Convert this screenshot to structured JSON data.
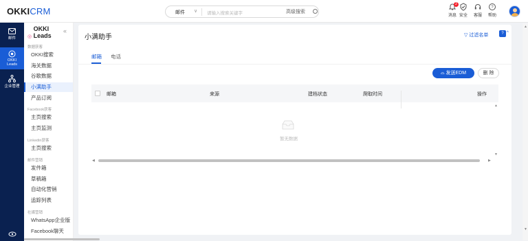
{
  "brand": {
    "logo_okki": "OKKI",
    "logo_crm": "CRM"
  },
  "search": {
    "type_label": "邮件",
    "placeholder": "请输入搜索关键字",
    "advanced_label": "高级搜索"
  },
  "top_actions": [
    {
      "label": "消息",
      "icon": "bell-icon",
      "badge": "2"
    },
    {
      "label": "安全",
      "icon": "shield-check-icon"
    },
    {
      "label": "客服",
      "icon": "headset-icon"
    },
    {
      "label": "帮助",
      "icon": "help-circle-icon"
    }
  ],
  "rail": [
    {
      "label": "邮件",
      "icon": "mail-icon"
    },
    {
      "label": "OKKI Leads",
      "icon": "leads-icon",
      "active": true
    },
    {
      "label": "企业管理",
      "icon": "org-icon"
    }
  ],
  "sidebar": {
    "title": "OKKI Leads",
    "sections": [
      {
        "heading": "数据获客",
        "items": [
          "OKKI搜索",
          "海关数据",
          "谷歌数据",
          "小满助手",
          "产品订阅"
        ]
      },
      {
        "heading": "Facebook获客",
        "items": [
          "主页搜索",
          "主页监测"
        ]
      },
      {
        "heading": "Linkedin获客",
        "items": [
          "主页搜索"
        ]
      },
      {
        "heading": "邮件营销",
        "items": [
          "发件箱",
          "草稿箱",
          "自动化营销",
          "追踪列表"
        ]
      },
      {
        "heading": "社媒营销",
        "items": [
          "WhatsApp企业版",
          "Facebook聊天"
        ]
      }
    ],
    "active_item": "小满助手"
  },
  "main": {
    "title": "小满助手",
    "filter_label": "过滤名单",
    "tabs": [
      {
        "label": "邮箱",
        "active": true
      },
      {
        "label": "电话",
        "active": false
      }
    ],
    "buttons": {
      "edm": "发送EDM",
      "delete": "删 除"
    },
    "table": {
      "columns": [
        "邮箱",
        "来源",
        "建档状态",
        "爬取时间",
        "操作"
      ],
      "rows": [],
      "empty_text": "暂无数据"
    }
  },
  "colors": {
    "brand_blue": "#1a5dd6",
    "rail_bg": "#0a2150",
    "badge_red": "#f5222d"
  }
}
